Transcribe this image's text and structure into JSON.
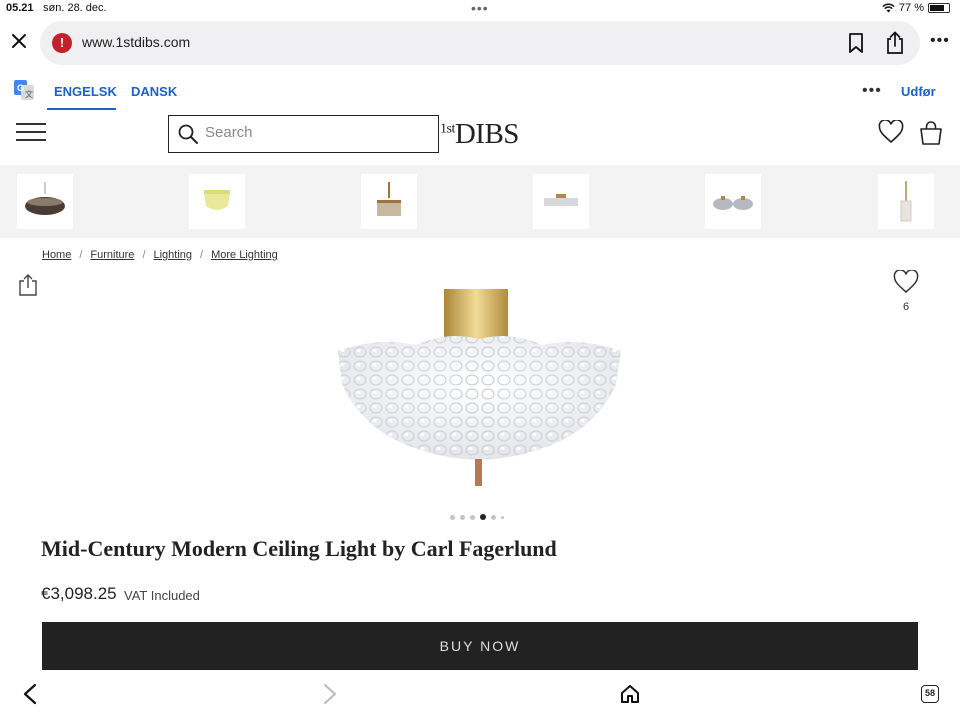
{
  "status": {
    "time": "05.21",
    "date": "søn. 28. dec.",
    "battery": "77 %",
    "battery_level": 0.77
  },
  "browser": {
    "url": "www.1stdibs.com"
  },
  "translate": {
    "tab_english": "ENGELSK",
    "tab_danish": "DANSK",
    "done_label": "Udfør"
  },
  "header": {
    "search_placeholder": "Search",
    "logo_text": "DIBS",
    "logo_prefix": "1st"
  },
  "breadcrumb": [
    "Home",
    "Furniture",
    "Lighting",
    "More Lighting"
  ],
  "favorites": {
    "count": "6"
  },
  "gallery": {
    "total": 6,
    "active_index": 3
  },
  "product": {
    "title": "Mid-Century Modern Ceiling Light by Carl Fagerlund",
    "price": "€3,098.25",
    "vat": "VAT Included",
    "buy_label": "BUY NOW"
  },
  "toolbar": {
    "tab_count": "58"
  },
  "colors": {
    "accent_blue": "#1a62c9",
    "buy_button": "#222222",
    "warning": "#c8202a"
  }
}
